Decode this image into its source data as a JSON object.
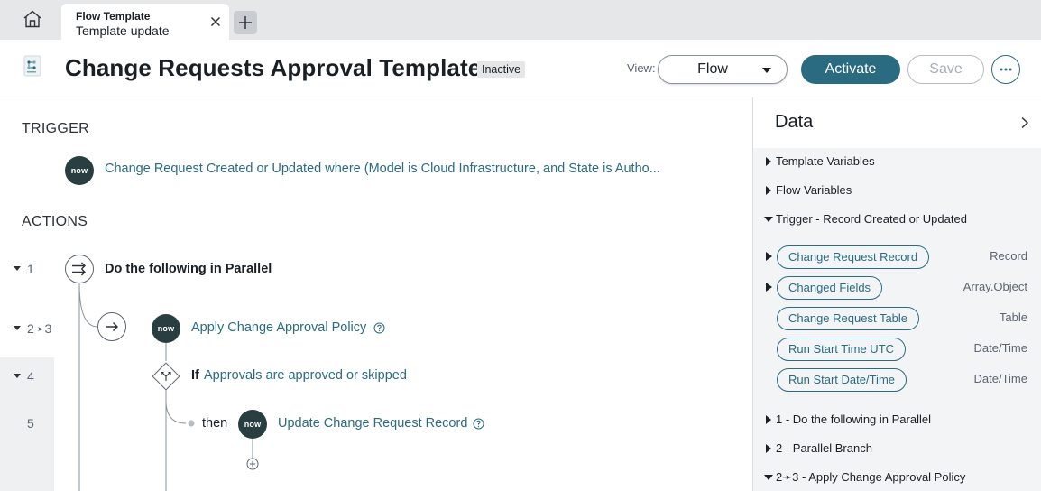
{
  "tab": {
    "title": "Flow Template",
    "subtitle": "Template update"
  },
  "header": {
    "title": "Change Requests Approval Template",
    "status": "Inactive",
    "view_label": "View:",
    "view_value": "Flow",
    "activate_label": "Activate",
    "save_label": "Save"
  },
  "trigger": {
    "heading": "TRIGGER",
    "logo": "now",
    "text": "Change Request Created or Updated where (Model is Cloud Infrastructure, and State is Autho..."
  },
  "actions": {
    "heading": "ACTIONS",
    "steps": [
      {
        "number": "1",
        "label": "Do the following in Parallel"
      },
      {
        "number": "2➛3",
        "label": "Apply Change Approval Policy"
      },
      {
        "number": "4",
        "if_label": "If",
        "condition": "Approvals are approved or skipped"
      },
      {
        "number": "5",
        "then_label": "then",
        "label": "Update Change Request Record"
      }
    ]
  },
  "data_panel": {
    "title": "Data",
    "sections": [
      {
        "label": "Template Variables",
        "expanded": false
      },
      {
        "label": "Flow Variables",
        "expanded": false
      },
      {
        "label": "Trigger - Record Created or Updated",
        "expanded": true
      },
      {
        "label": "1 - Do the following in Parallel",
        "expanded": false
      },
      {
        "label": "2 - Parallel Branch",
        "expanded": false
      },
      {
        "label": "2➛3 - Apply Change Approval Policy",
        "expanded": true
      }
    ],
    "pills": [
      {
        "label": "Change Request Record",
        "type": "Record",
        "expandable": true
      },
      {
        "label": "Changed Fields",
        "type": "Array.Object",
        "expandable": true
      },
      {
        "label": "Change Request Table",
        "type": "Table",
        "expandable": false
      },
      {
        "label": "Run Start Time UTC",
        "type": "Date/Time",
        "expandable": false
      },
      {
        "label": "Run Start Date/Time",
        "type": "Date/Time",
        "expandable": false
      }
    ]
  },
  "colors": {
    "accent": "#2a6b82",
    "now_logo_bg": "#293e40",
    "tabbar_bg": "#e6e7e9"
  },
  "icons": [
    "home-icon",
    "close-icon",
    "plus-icon",
    "flow-template-icon",
    "chevron-down-icon",
    "more-icon",
    "parallel-icon",
    "arrow-right-icon",
    "branch-icon",
    "info-icon",
    "add-circle-icon",
    "chevron-right-icon"
  ]
}
